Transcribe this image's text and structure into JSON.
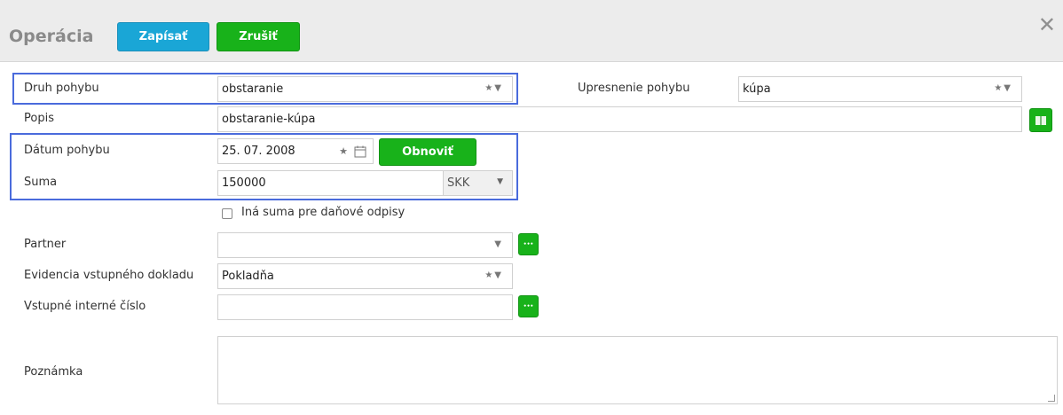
{
  "header": {
    "title": "Operácia",
    "save_label": "Zapísať",
    "cancel_label": "Zrušiť",
    "close_glyph": "✕"
  },
  "form": {
    "druh_pohybu": {
      "label": "Druh pohybu",
      "value": "obstaranie"
    },
    "upresnenie_pohybu": {
      "label": "Upresnenie pohybu",
      "value": "kúpa"
    },
    "popis": {
      "label": "Popis",
      "value": "obstaranie-kúpa"
    },
    "datum_pohybu": {
      "label": "Dátum pohybu",
      "value": "25. 07. 2008",
      "refresh_label": "Obnoviť"
    },
    "suma": {
      "label": "Suma",
      "value": "150000",
      "currency": "SKK"
    },
    "ina_suma": {
      "label": "Iná suma pre daňové odpisy",
      "checked": false
    },
    "partner": {
      "label": "Partner",
      "value": ""
    },
    "evidencia": {
      "label": "Evidencia vstupného dokladu",
      "value": "Pokladňa"
    },
    "vstupne_cislo": {
      "label": "Vstupné interné číslo",
      "value": ""
    },
    "poznamka": {
      "label": "Poznámka",
      "value": ""
    }
  },
  "icons": {
    "star": "★",
    "dropdown": "▼",
    "calendar": "calendar-icon",
    "ellipsis": "•••",
    "book": "book-icon"
  },
  "colors": {
    "blue_button": "#1aa6d6",
    "green_button": "#18b21a",
    "highlight": "#4a6bdc",
    "header_bg": "#ececec"
  }
}
